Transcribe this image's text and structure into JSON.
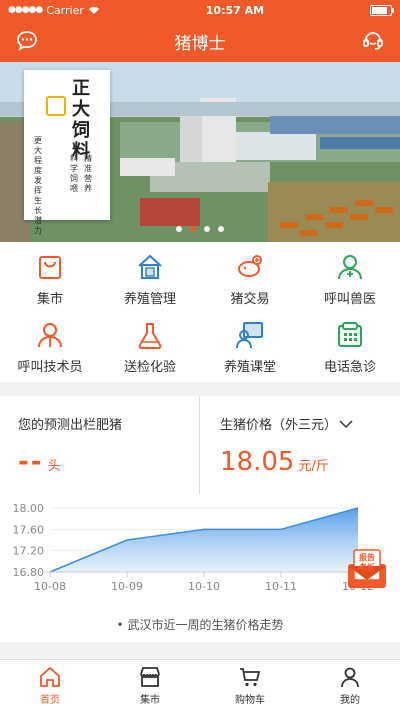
{
  "status": {
    "carrier": "Carrier",
    "time": "10:57 AM",
    "battery_level": 0.95
  },
  "header": {
    "title": "猪博士",
    "left_icon": "chat-bubble-icon",
    "right_icon": "customer-service-icon"
  },
  "banner": {
    "poster_brand": [
      "正",
      "大",
      "饲",
      "料"
    ],
    "poster_slogan_cols": [
      "精准营养",
      "科学饲喂",
      "更大程度发挥生长潜力"
    ],
    "slide_count": 4,
    "active_slide": 1
  },
  "menu": [
    {
      "label": "集市",
      "icon": "shopping-bag-icon"
    },
    {
      "label": "养殖管理",
      "icon": "house-doc-icon"
    },
    {
      "label": "猪交易",
      "icon": "pig-icon"
    },
    {
      "label": "呼叫兽医",
      "icon": "vet-icon"
    },
    {
      "label": "呼叫技术员",
      "icon": "technician-icon"
    },
    {
      "label": "送检化验",
      "icon": "flask-icon"
    },
    {
      "label": "养殖课堂",
      "icon": "classroom-icon"
    },
    {
      "label": "电话急诊",
      "icon": "telephone-icon"
    }
  ],
  "forecast": {
    "label": "您的预测出栏肥猪",
    "value": "--",
    "unit": "头"
  },
  "price": {
    "label": "生猪价格（外三元）",
    "value": "18.05",
    "unit": "元/斤"
  },
  "chart_data": {
    "type": "area",
    "x": [
      "10-08",
      "10-09",
      "10-10",
      "10-11",
      "10-12"
    ],
    "series": [
      {
        "values": [
          16.8,
          17.4,
          17.6,
          17.6,
          18.0
        ]
      }
    ],
    "y_ticks": [
      "18.00",
      "17.60",
      "17.20",
      "16.80"
    ],
    "ylim": [
      16.8,
      18.0
    ],
    "caption": "• 武汉市近一周的生猪价格走势",
    "color": "#3a8ee6"
  },
  "report_badge": {
    "label": "报告老板"
  },
  "tabbar": [
    {
      "label": "首页",
      "icon": "home-icon",
      "active": true
    },
    {
      "label": "集市",
      "icon": "store-icon",
      "active": false
    },
    {
      "label": "购物车",
      "icon": "cart-icon",
      "active": false
    },
    {
      "label": "我的",
      "icon": "profile-icon",
      "active": false
    }
  ]
}
